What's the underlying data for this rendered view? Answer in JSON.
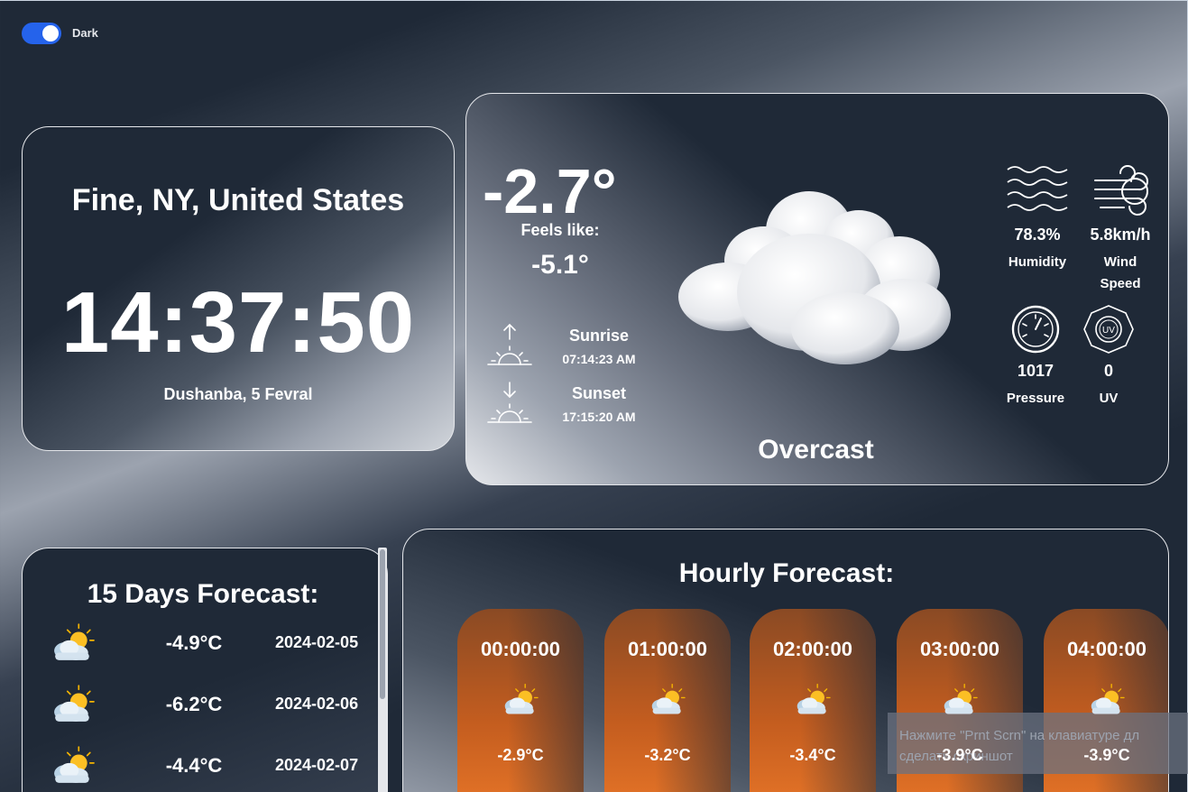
{
  "theme_toggle": {
    "label": "Dark",
    "on": true
  },
  "clock": {
    "location": "Fine, NY, United States",
    "time": "14:37:50",
    "date": "Dushanba, 5 Fevral"
  },
  "current": {
    "temperature": "-2.7°",
    "feels_like_label": "Feels like:",
    "feels_like": "-5.1°",
    "sunrise_label": "Sunrise",
    "sunrise_time": "07:14:23 AM",
    "sunset_label": "Sunset",
    "sunset_time": "17:15:20 AM",
    "condition": "Overcast",
    "stats": {
      "humidity_value": "78.3%",
      "humidity_label": "Humidity",
      "wind_value": "5.8km/h",
      "wind_label_1": "Wind",
      "wind_label_2": "Speed",
      "pressure_value": "1017",
      "pressure_label": "Pressure",
      "uv_value": "0",
      "uv_label": "UV",
      "uv_icon_text": "UV"
    }
  },
  "days_forecast": {
    "title": "15 Days Forecast:",
    "items": [
      {
        "temp": "-4.9°C",
        "date": "2024-02-05",
        "icon": "partly-cloudy-sun-icon"
      },
      {
        "temp": "-6.2°C",
        "date": "2024-02-06",
        "icon": "partly-cloudy-sun-icon"
      },
      {
        "temp": "-4.4°C",
        "date": "2024-02-07",
        "icon": "partly-cloudy-sun-icon"
      }
    ]
  },
  "hourly_forecast": {
    "title": "Hourly Forecast:",
    "items": [
      {
        "time": "00:00:00",
        "temp": "-2.9°C",
        "icon": "partly-cloudy-sun-icon"
      },
      {
        "time": "01:00:00",
        "temp": "-3.2°C",
        "icon": "partly-cloudy-sun-icon"
      },
      {
        "time": "02:00:00",
        "temp": "-3.4°C",
        "icon": "partly-cloudy-sun-icon"
      },
      {
        "time": "03:00:00",
        "temp": "-3.9°C",
        "icon": "partly-cloudy-sun-icon"
      },
      {
        "time": "04:00:00",
        "temp": "-3.9°C",
        "icon": "partly-cloudy-sun-icon"
      }
    ]
  },
  "system_toast": {
    "line1": "Нажмите \"Prnt Scrn\" на клавиатуре дл",
    "line2": "сделать скриншот"
  },
  "colors": {
    "card_bg": "#1f2937",
    "toggle_accent": "#2563eb",
    "hour_card_orange": "#e87628"
  }
}
